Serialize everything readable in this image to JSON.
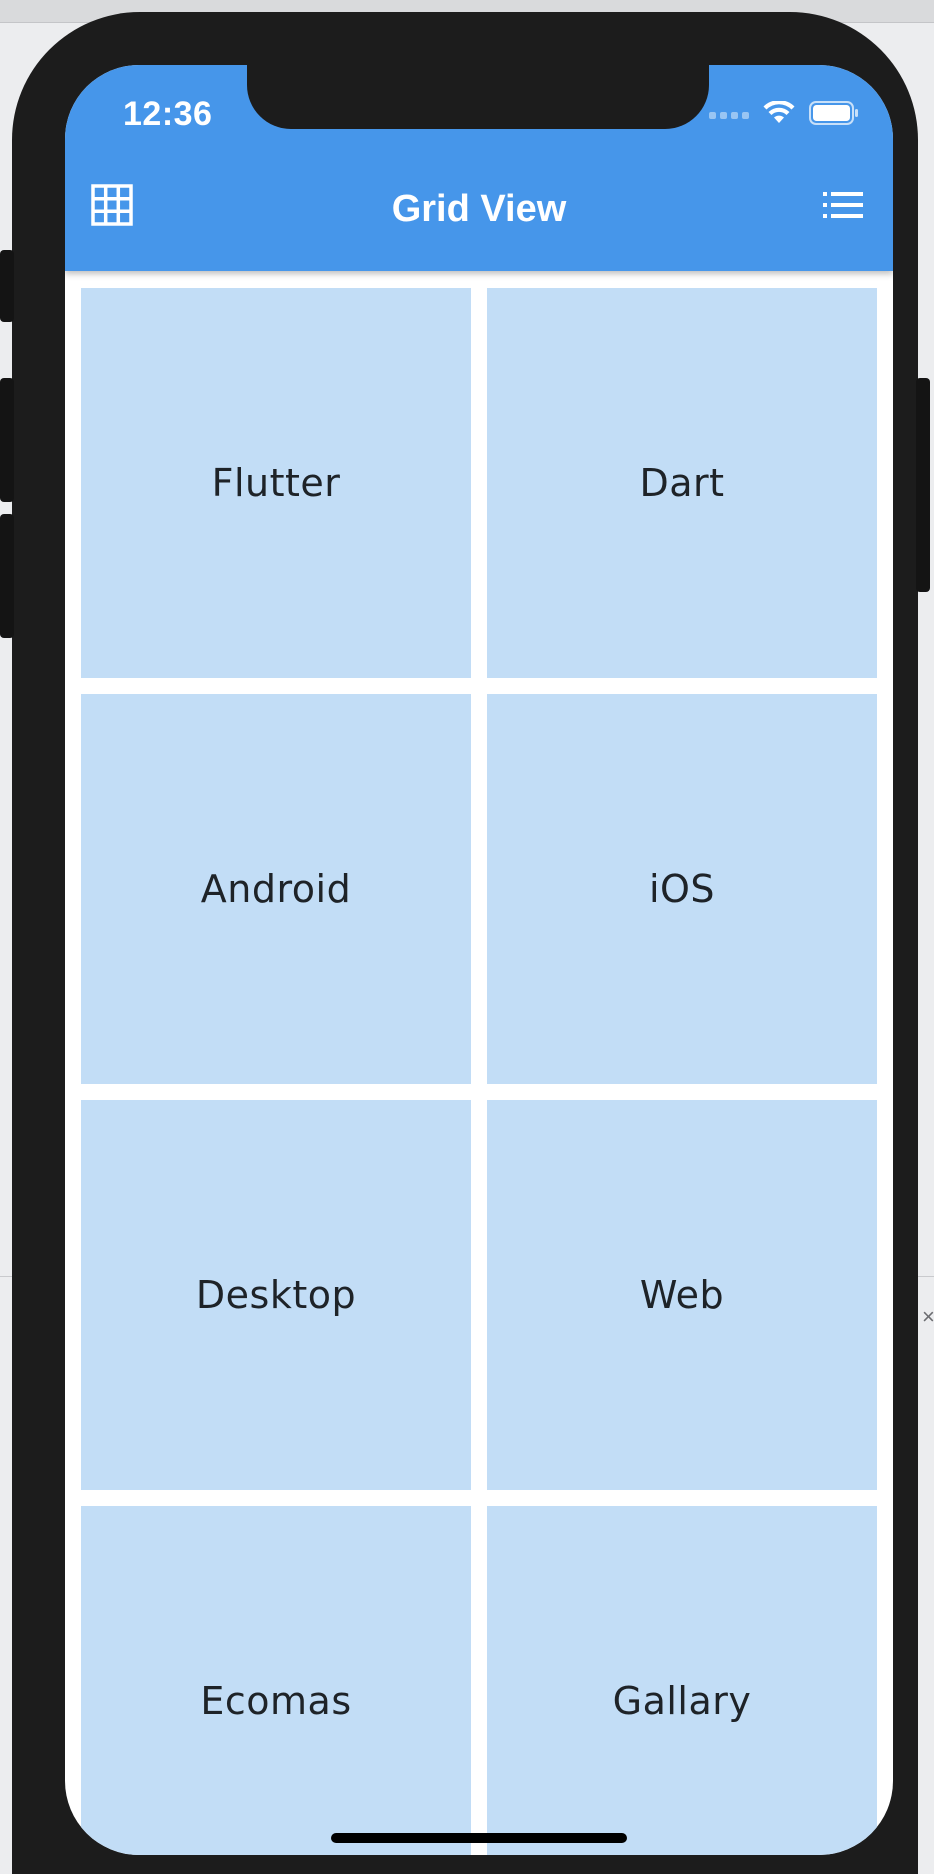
{
  "status_bar": {
    "time": "12:36"
  },
  "app_bar": {
    "title": "Grid View",
    "leading_icon": "grid-icon",
    "trailing_icon": "list-icon",
    "color": "#4696ea"
  },
  "grid": {
    "tile_color": "#c2ddf6",
    "items": [
      {
        "label": "Flutter"
      },
      {
        "label": "Dart"
      },
      {
        "label": "Android"
      },
      {
        "label": "iOS"
      },
      {
        "label": "Desktop"
      },
      {
        "label": "Web"
      },
      {
        "label": "Ecomas"
      },
      {
        "label": "Gallary"
      }
    ]
  }
}
